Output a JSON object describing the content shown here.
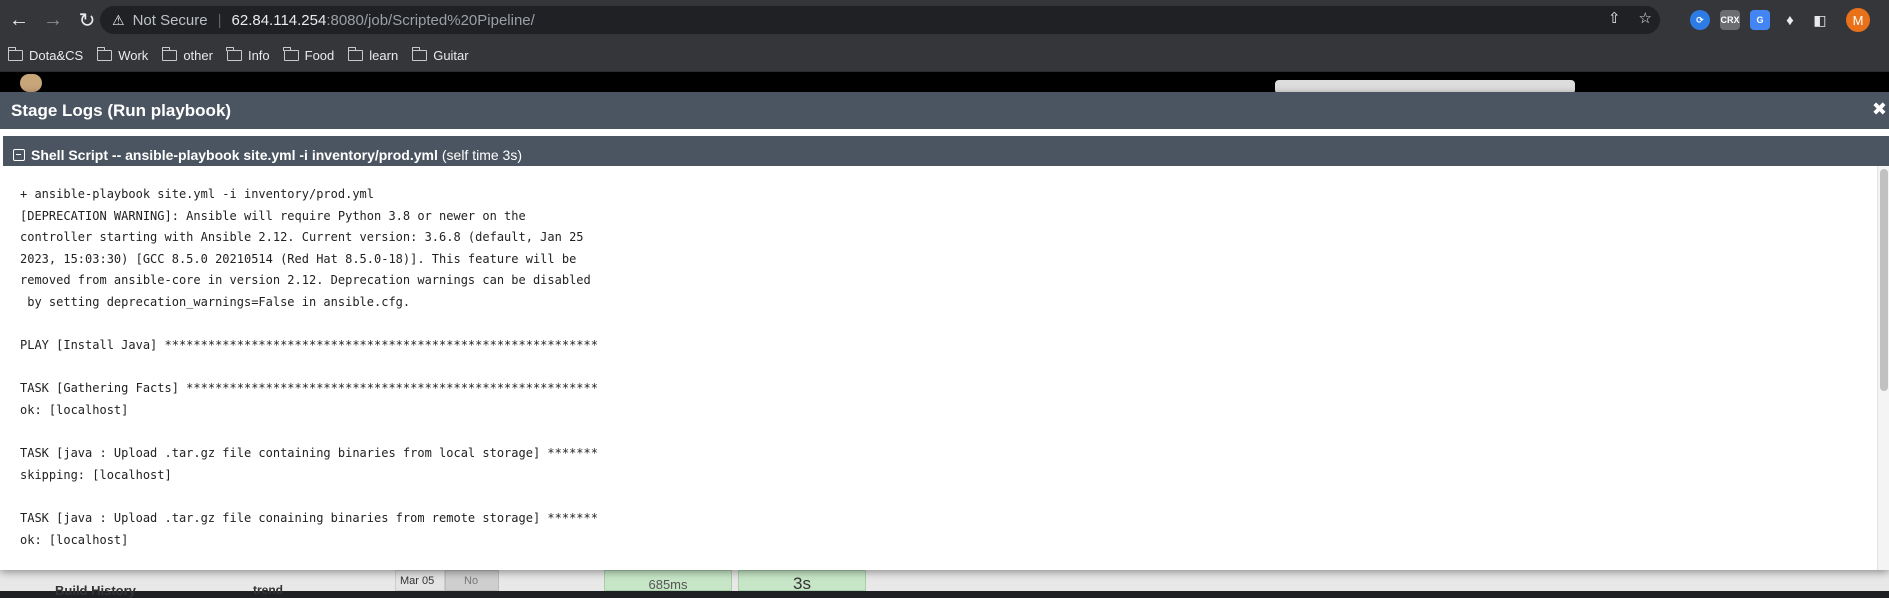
{
  "browser": {
    "security_label": "Not Secure",
    "url_host": "62.84.114.254",
    "url_path": ":8080/job/Scripted%20Pipeline/",
    "avatar_letter": "M",
    "bookmarks": [
      "Dota&CS",
      "Work",
      "other",
      "Info",
      "Food",
      "learn",
      "Guitar"
    ]
  },
  "background_page": {
    "build_history_label": "Build History",
    "trend_label": "trend",
    "date_cell": "Mar 05",
    "no_cell": "No",
    "stage_time_1": "685ms",
    "stage_time_2": "3s"
  },
  "modal": {
    "title": "Stage Logs (Run playbook)",
    "close_symbol": "✖",
    "step_name": "Shell Script -- ansible-playbook site.yml -i inventory/prod.yml",
    "step_time": "(self time 3s)",
    "log_text": "+ ansible-playbook site.yml -i inventory/prod.yml\n[DEPRECATION WARNING]: Ansible will require Python 3.8 or newer on the\ncontroller starting with Ansible 2.12. Current version: 3.6.8 (default, Jan 25\n2023, 15:03:30) [GCC 8.5.0 20210514 (Red Hat 8.5.0-18)]. This feature will be\nremoved from ansible-core in version 2.12. Deprecation warnings can be disabled\n by setting deprecation_warnings=False in ansible.cfg.\n\nPLAY [Install Java] ************************************************************\n\nTASK [Gathering Facts] *********************************************************\nok: [localhost]\n\nTASK [java : Upload .tar.gz file containing binaries from local storage] *******\nskipping: [localhost]\n\nTASK [java : Upload .tar.gz file conaining binaries from remote storage] *******\nok: [localhost]"
  }
}
